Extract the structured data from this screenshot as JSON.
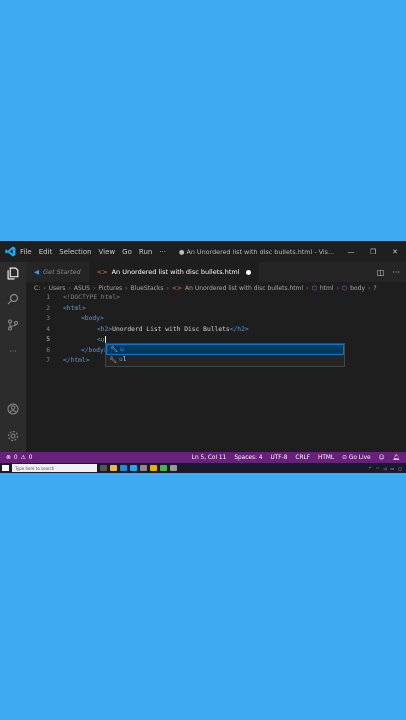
{
  "window": {
    "menu": [
      "File",
      "Edit",
      "Selection",
      "View",
      "Go",
      "Run",
      "···"
    ],
    "title": "● An Unordered list with disc bullets.html - Vis..."
  },
  "tabs": [
    {
      "label": "Get Started",
      "active": false
    },
    {
      "label": "An Unordered list with disc bullets.html",
      "active": true,
      "dirty": true
    }
  ],
  "breadcrumb": [
    "C:",
    "Users",
    "ASUS",
    "Pictures",
    "BlueStacks",
    "An Unordered list with disc bullets.html",
    "html",
    "body",
    "?"
  ],
  "editor": {
    "line_numbers": [
      "1",
      "2",
      "3",
      "4",
      "5",
      "6",
      "7"
    ],
    "lines": {
      "l1": "<!DOCTYPE html>",
      "l2": "<html>",
      "l3": "<body>",
      "l4_open": "<h2>",
      "l4_text": "Unorderd List with Disc Bullets",
      "l4_close": "</h2>",
      "l5": "<u",
      "l6": "</body>",
      "l7": "</html>"
    }
  },
  "suggestions": [
    {
      "match": "u",
      "rest": "",
      "selected": true
    },
    {
      "match": "u",
      "rest": "l",
      "selected": false
    }
  ],
  "statusbar": {
    "errors": "0",
    "warnings": "0",
    "position": "Ln 5, Col 11",
    "spaces": "Spaces: 4",
    "encoding": "UTF-8",
    "eol": "CRLF",
    "language": "HTML",
    "golive": "Go Live"
  },
  "taskbar": {
    "search_placeholder": "Type here to search"
  },
  "colors": {
    "background": "#3daaf2",
    "statusbar": "#68217a",
    "accent": "#0078d4"
  }
}
